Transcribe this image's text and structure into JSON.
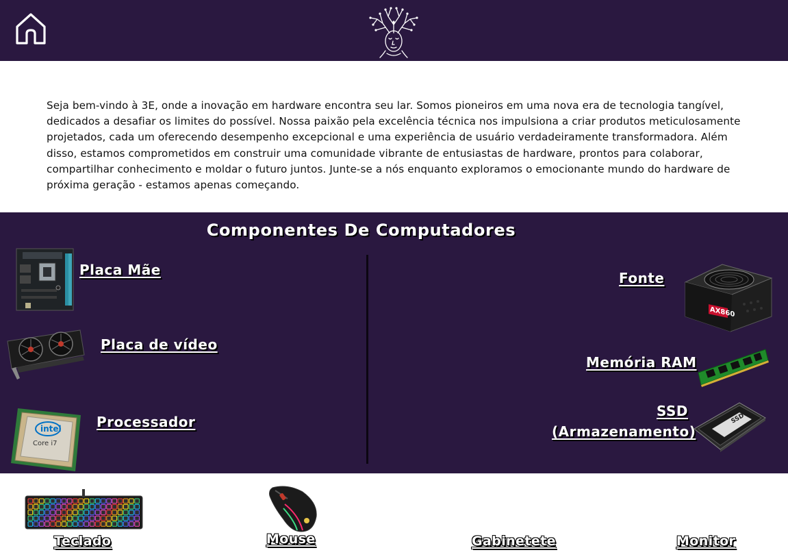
{
  "header": {
    "home_icon": "home-icon",
    "logo_icon": "tree-face-logo-icon",
    "background": "#2a1840"
  },
  "intro": {
    "text": "Seja bem-vindo à 3E, onde a inovação em hardware encontra seu lar. Somos pioneiros em uma nova era de tecnologia tangível, dedicados a desafiar os limites do possível. Nossa paixão pela excelência técnica nos impulsiona a criar produtos meticulosamente projetados, cada um oferecendo desempenho excepcional e uma experiência de usuário verdadeiramente transformadora. Além disso, estamos comprometidos em construir uma comunidade vibrante de entusiastas de hardware, prontos para colaborar, compartilhar conhecimento e moldar o futuro juntos. Junte-se a nós enquanto exploramos o emocionante mundo do hardware de próxima geração - estamos apenas começando."
  },
  "components": {
    "title": "Componentes De Computadores",
    "left": [
      {
        "label": "Placa Mãe",
        "icon": "motherboard-icon"
      },
      {
        "label": "Placa de vídeo",
        "icon": "graphics-card-icon"
      },
      {
        "label": "Processador",
        "icon": "cpu-icon"
      }
    ],
    "right": [
      {
        "label": "Fonte",
        "icon": "power-supply-icon",
        "badge": "AX860"
      },
      {
        "label": "Memória RAM",
        "icon": "ram-module-icon"
      },
      {
        "label_line1": "SSD",
        "label_line2": "(Armazenamento)",
        "icon": "ssd-icon",
        "badge": "SSD"
      }
    ]
  },
  "peripherals": [
    {
      "label": "Teclado",
      "icon": "keyboard-icon"
    },
    {
      "label": "Mouse",
      "icon": "mouse-icon"
    },
    {
      "label": "Gabinetete"
    },
    {
      "label": "Monitor"
    }
  ],
  "colors": {
    "brand_purple": "#2a1840",
    "link_text": "#ffffff",
    "body_text": "#111111"
  }
}
